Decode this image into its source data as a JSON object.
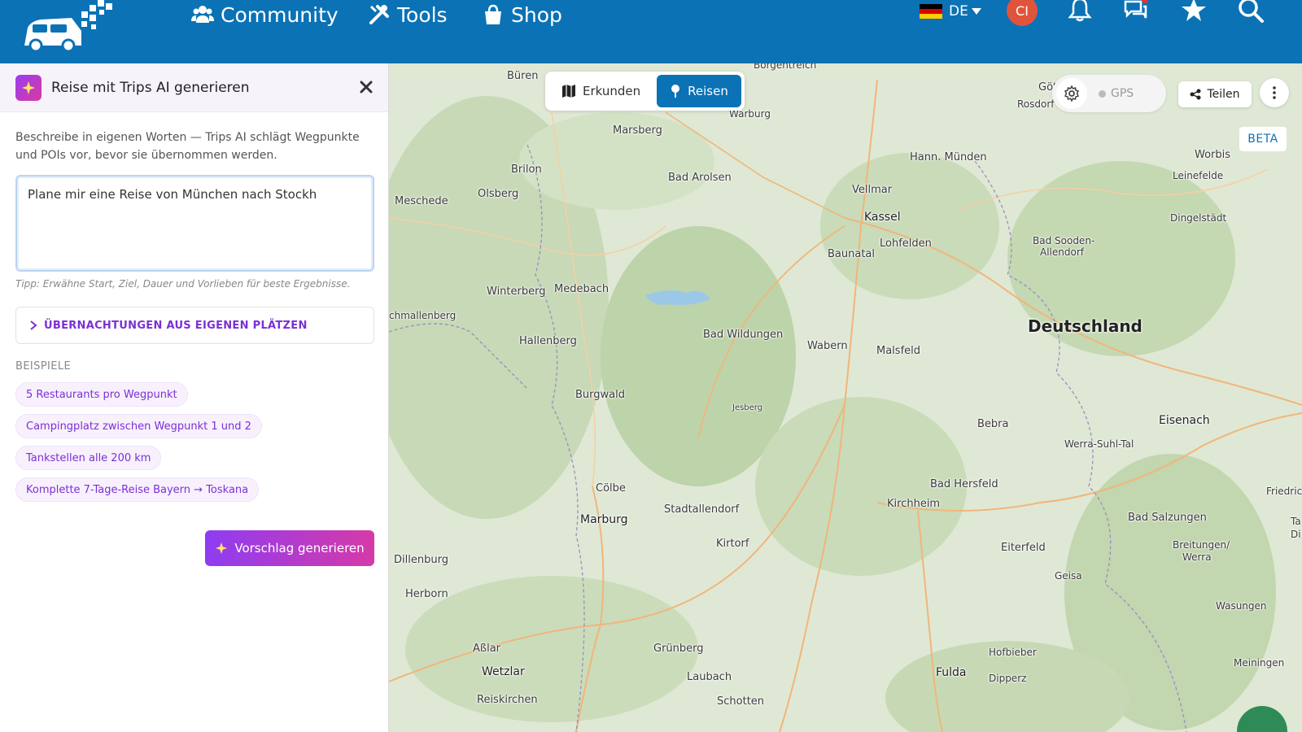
{
  "nav": {
    "items": [
      {
        "label": "Community",
        "icon": "users-icon"
      },
      {
        "label": "Tools",
        "icon": "tools-icon"
      },
      {
        "label": "Shop",
        "icon": "shopping-bag-icon"
      }
    ],
    "language": "DE",
    "avatar_initials": "CI",
    "color": "#0b72b5"
  },
  "panel": {
    "title": "Reise mit Trips AI generieren",
    "description": "Beschreibe in eigenen Worten — Trips AI schlägt Wegpunkte und POIs vor, bevor sie übernommen werden.",
    "prompt_value": "Plane mir eine Reise von München nach Stockh",
    "tip": "Tipp: Erwähne Start, Ziel, Dauer und Vorlieben für beste Ergebnisse.",
    "accordion_label": "ÜBERNACHTUNGEN AUS EIGENEN PLÄTZEN",
    "examples_label": "BEISPIELE",
    "examples": [
      "5 Restaurants pro Wegpunkt",
      "Campingplatz zwischen Wegpunkt 1 und 2",
      "Tankstellen alle 200 km",
      "Komplette 7-Tage-Reise Bayern → Toskana"
    ],
    "generate_label": "Vorschlag generieren",
    "accent": "#7b2fd6"
  },
  "map": {
    "mode_explore": "Erkunden",
    "mode_travel": "Reisen",
    "gps_label": "GPS",
    "share_label": "Teilen",
    "beta_label": "BETA",
    "places": {
      "bueren": "Büren",
      "borgentreich": "Borgentreich",
      "goett": "Götti",
      "rosdorf": "Rosdorf",
      "warburg": "Warburg",
      "marsberg": "Marsberg",
      "hann": "Hann. Münden",
      "worbis": "Worbis",
      "brilon": "Brilon",
      "badarolsen": "Bad Arolsen",
      "leinefelde": "Leinefelde",
      "meschede": "Meschede",
      "olsberg": "Olsberg",
      "vellmar": "Vellmar",
      "kassel": "Kassel",
      "dingelstaedt": "Dingelstädt",
      "lohfelden": "Lohfelden",
      "badsooden": "Bad Sooden-",
      "allendorf": "Allendorf",
      "baunatal": "Baunatal",
      "winterberg": "Winterberg",
      "medebach": "Medebach",
      "schmallenberg": "chmallenberg",
      "deutschland": "Deutschland",
      "badwildungen": "Bad Wildungen",
      "hallenberg": "Hallenberg",
      "wabern": "Wabern",
      "malsfeld": "Malsfeld",
      "burgwald": "Burgwald",
      "jesberg": "Jesberg",
      "bebra": "Bebra",
      "eisenach": "Eisenach",
      "werra": "Werra-Suhl-Tal",
      "coelbe": "Cölbe",
      "badhersfeld": "Bad Hersfeld",
      "friedrich": "Friedrich",
      "stadtallendorf": "Stadtallendorf",
      "kirchheim": "Kirchheim",
      "marburg": "Marburg",
      "badsalzungen": "Bad Salzungen",
      "ta": "Ta",
      "di": "Di",
      "kirtorf": "Kirtorf",
      "breitungen": "Breitungen/",
      "werra2": "Werra",
      "eiterfeld": "Eiterfeld",
      "dillenburg": "Dillenburg",
      "geisa": "Geisa",
      "herborn": "Herborn",
      "wasungen": "Wasungen",
      "asslar": "Aßlar",
      "gruenberg": "Grünberg",
      "hofbieber": "Hofbieber",
      "wetzlar": "Wetzlar",
      "fulda": "Fulda",
      "meiningen": "Meiningen",
      "laubach": "Laubach",
      "dipperz": "Dipperz",
      "reiskirchen": "Reiskirchen",
      "schotten": "Schotten"
    }
  }
}
